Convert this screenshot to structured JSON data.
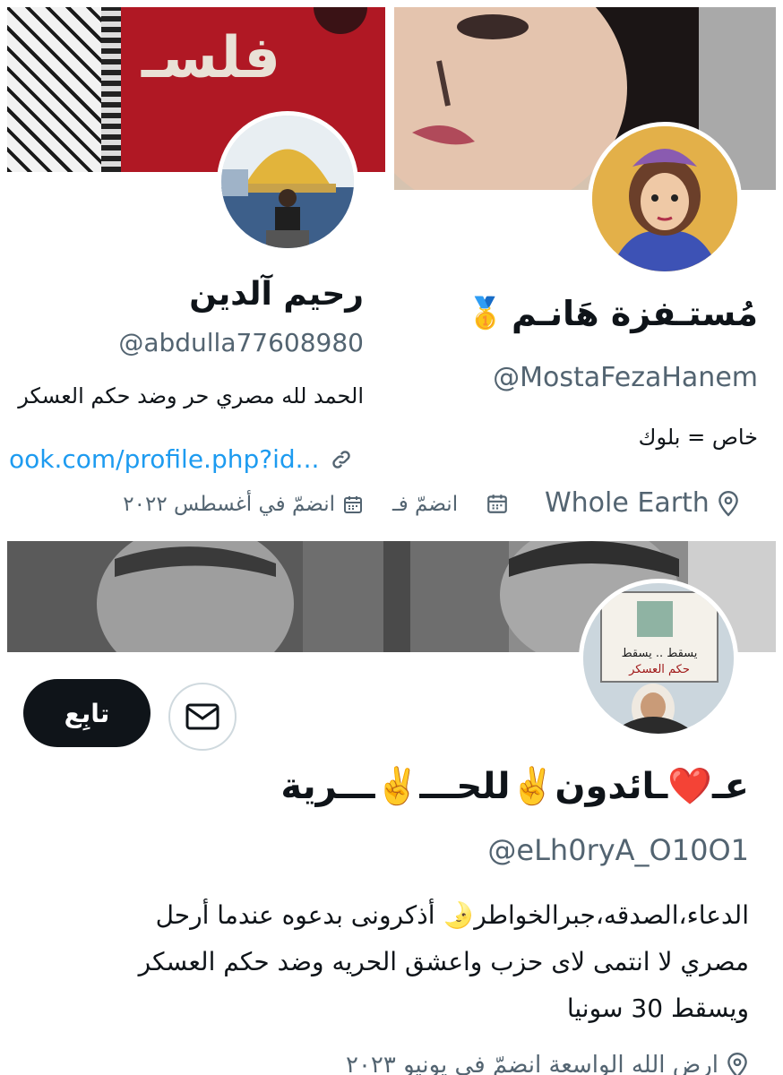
{
  "profile_left": {
    "banner_text": "فلسـ",
    "name": "رحيم آلدين",
    "handle": "@abdulla77608980",
    "bio": "الحمد لله مصري حر وضد حكم العسكر",
    "link": "ook.com/profile.php?id...",
    "joined": "انضمّ في أغسطس ٢٠٢٢",
    "joined_partial": "انضمّ فـ"
  },
  "profile_right": {
    "name": "مُستـفزة هَانـم",
    "badge": "🥇",
    "handle": "@MostaFezaHanem",
    "bio": "خاص = بلوك",
    "location": "Whole Earth"
  },
  "profile_bottom": {
    "name": "عـ❤️ـائدون✌️للحـــ✌️ـــرية",
    "handle": "@eLh0ryA_O10O1",
    "follow_label": "تابِع",
    "bio_lines": [
      "الدعاء،الصدقه،جبرالخواطر🌛 أذكرونى بدعوه عندما أرحل",
      "مصري لا انتمى لاى حزب واعشق الحريه وضد حكم العسكر",
      "ويسقط 30 سونيا"
    ],
    "meta_partial": "ارض الله الواسعة  انضمّ في يونيو ٢٠٢٣",
    "sign_text_1": "يسقط .. يسقط",
    "sign_text_2": "حكم العسكر"
  },
  "colors": {
    "link": "#1d9bf0",
    "secondary_text": "#536471",
    "follow_bg": "#0f1419",
    "banner_red": "#b01824"
  }
}
